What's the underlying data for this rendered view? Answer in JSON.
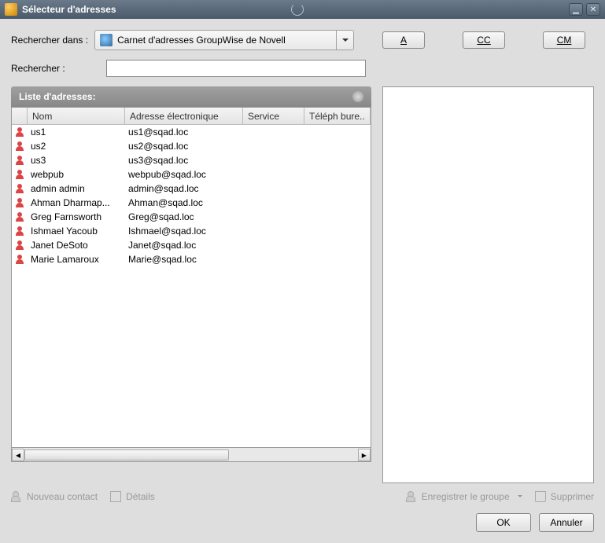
{
  "window": {
    "title": "Sélecteur d'adresses"
  },
  "labels": {
    "search_in": "Rechercher dans :",
    "search": "Rechercher :",
    "list_header": "Liste d'adresses:"
  },
  "combo": {
    "selected": "Carnet d'adresses GroupWise de Novell"
  },
  "type_buttons": {
    "a": "A",
    "cc": "CC",
    "cm": "CM"
  },
  "columns": {
    "name": "Nom",
    "email": "Adresse électronique",
    "service": "Service",
    "phone": "Téléph bure.."
  },
  "rows": [
    {
      "name": "us1",
      "email": "us1@sqad.loc"
    },
    {
      "name": "us2",
      "email": "us2@sqad.loc"
    },
    {
      "name": "us3",
      "email": "us3@sqad.loc"
    },
    {
      "name": "webpub",
      "email": "webpub@sqad.loc"
    },
    {
      "name": "admin admin",
      "email": "admin@sqad.loc"
    },
    {
      "name": "Ahman Dharmap...",
      "email": "Ahman@sqad.loc"
    },
    {
      "name": "Greg Farnsworth",
      "email": "Greg@sqad.loc"
    },
    {
      "name": "Ishmael Yacoub",
      "email": "Ishmael@sqad.loc"
    },
    {
      "name": "Janet DeSoto",
      "email": "Janet@sqad.loc"
    },
    {
      "name": "Marie Lamaroux",
      "email": "Marie@sqad.loc"
    }
  ],
  "footer": {
    "new_contact": "Nouveau contact",
    "details": "Détails",
    "save_group": "Enregistrer le groupe",
    "delete": "Supprimer"
  },
  "buttons": {
    "ok": "OK",
    "cancel": "Annuler"
  }
}
